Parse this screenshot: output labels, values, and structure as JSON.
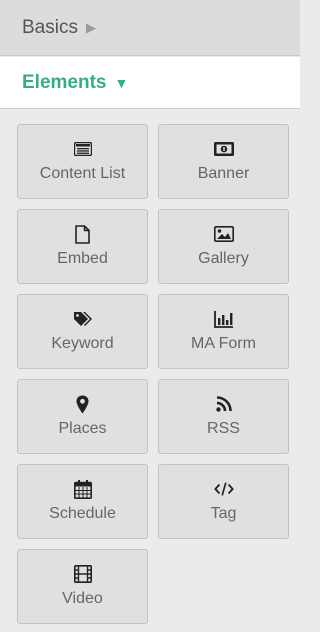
{
  "sections": {
    "basics": {
      "label": "Basics",
      "arrow": "▶"
    },
    "elements": {
      "label": "Elements",
      "arrow": "▼"
    }
  },
  "colors": {
    "accent": "#3aaa8c",
    "icon": "#222222",
    "label": "#666666"
  },
  "elements": [
    {
      "label": "Content List",
      "icon": "list-icon"
    },
    {
      "label": "Banner",
      "icon": "banner-icon"
    },
    {
      "label": "Embed",
      "icon": "document-icon"
    },
    {
      "label": "Gallery",
      "icon": "image-icon"
    },
    {
      "label": "Keyword",
      "icon": "tags-icon"
    },
    {
      "label": "MA Form",
      "icon": "bar-chart-icon"
    },
    {
      "label": "Places",
      "icon": "map-marker-icon"
    },
    {
      "label": "RSS",
      "icon": "rss-icon"
    },
    {
      "label": "Schedule",
      "icon": "calendar-icon"
    },
    {
      "label": "Tag",
      "icon": "code-icon"
    },
    {
      "label": "Video",
      "icon": "film-icon"
    }
  ]
}
